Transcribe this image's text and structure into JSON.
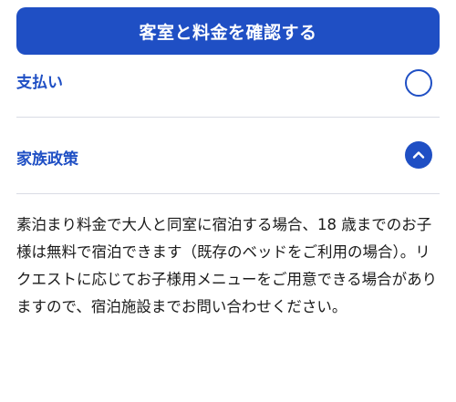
{
  "cta": {
    "label": "客室と料金を確認する"
  },
  "previous_section": {
    "title": "支払い"
  },
  "section": {
    "title": "家族政策",
    "body": "素泊まり料金で大人と同室に宿泊する場合、18 歳までのお子様は無料で宿泊できます（既存のベッドをご利用の場合）。リクエストに応じてお子様用メニューをご用意できる場合がありますので、宿泊施設までお問い合わせください。"
  },
  "colors": {
    "accent": "#1f4fc4",
    "divider": "#d9dce4",
    "text": "#1a1a1a"
  },
  "icons": {
    "collapse": "chevron-up-icon",
    "expand": "chevron-down-icon"
  }
}
